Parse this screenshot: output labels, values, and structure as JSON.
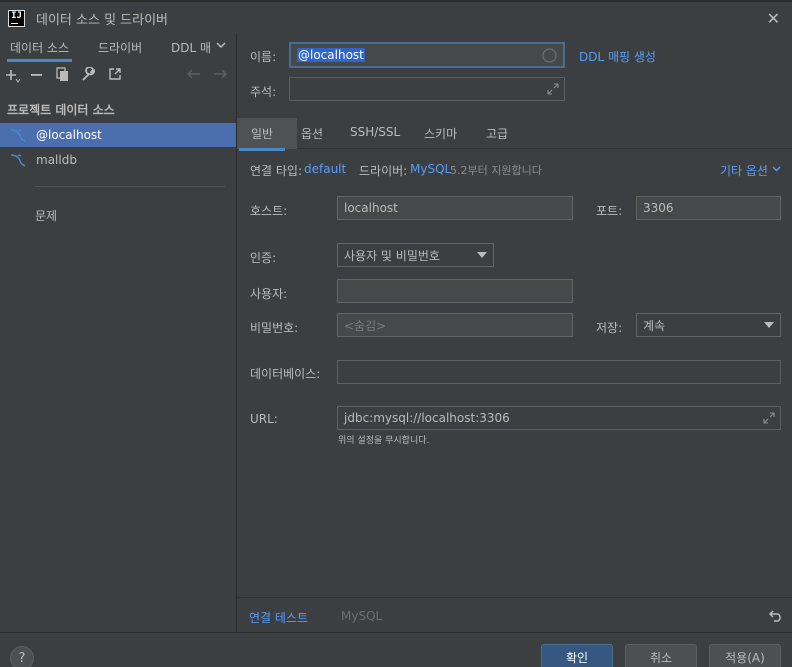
{
  "window": {
    "title": "데이터 소스 및 드라이버"
  },
  "left": {
    "tabs": [
      "데이터 소스",
      "드라이버",
      "DDL 매"
    ],
    "section_title": "프로젝트 데이터 소스",
    "items": [
      {
        "label": "@localhost",
        "selected": true
      },
      {
        "label": "malldb",
        "selected": false
      }
    ],
    "problems": "문제"
  },
  "form": {
    "name_label": "이름:",
    "name_value": "@localhost",
    "ddl_mapping": "DDL 매핑 생성",
    "comment_label": "주석:",
    "tabs": [
      "일반",
      "옵션",
      "SSH/SSL",
      "스키마",
      "고급"
    ],
    "conn_type_label": "연결 타입:",
    "conn_type_value": "default",
    "driver_label": "드라이버:",
    "driver_value": "MySQL",
    "driver_note": "5.2부터 지원합니다",
    "other_options": "기타 옵션",
    "host_label": "호스트:",
    "host_value": "localhost",
    "port_label": "포트:",
    "port_value": "3306",
    "auth_label": "인증:",
    "auth_value": "사용자 및 비밀번호",
    "user_label": "사용자:",
    "password_label": "비밀번호:",
    "password_placeholder": "<숨김>",
    "save_label": "저장:",
    "save_value": "계속",
    "database_label": "데이터베이스:",
    "url_label": "URL:",
    "url_value": "jdbc:mysql://localhost:3306",
    "url_hint": "위의 설정을 무시합니다.",
    "test_connection": "연결 테스트",
    "test_driver": "MySQL"
  },
  "footer": {
    "help": "?",
    "ok": "확인",
    "cancel": "취소",
    "apply": "적용(A)"
  },
  "colors": {
    "accent": "#589df6",
    "selection": "#4b6eaf",
    "primary_button": "#365880"
  }
}
